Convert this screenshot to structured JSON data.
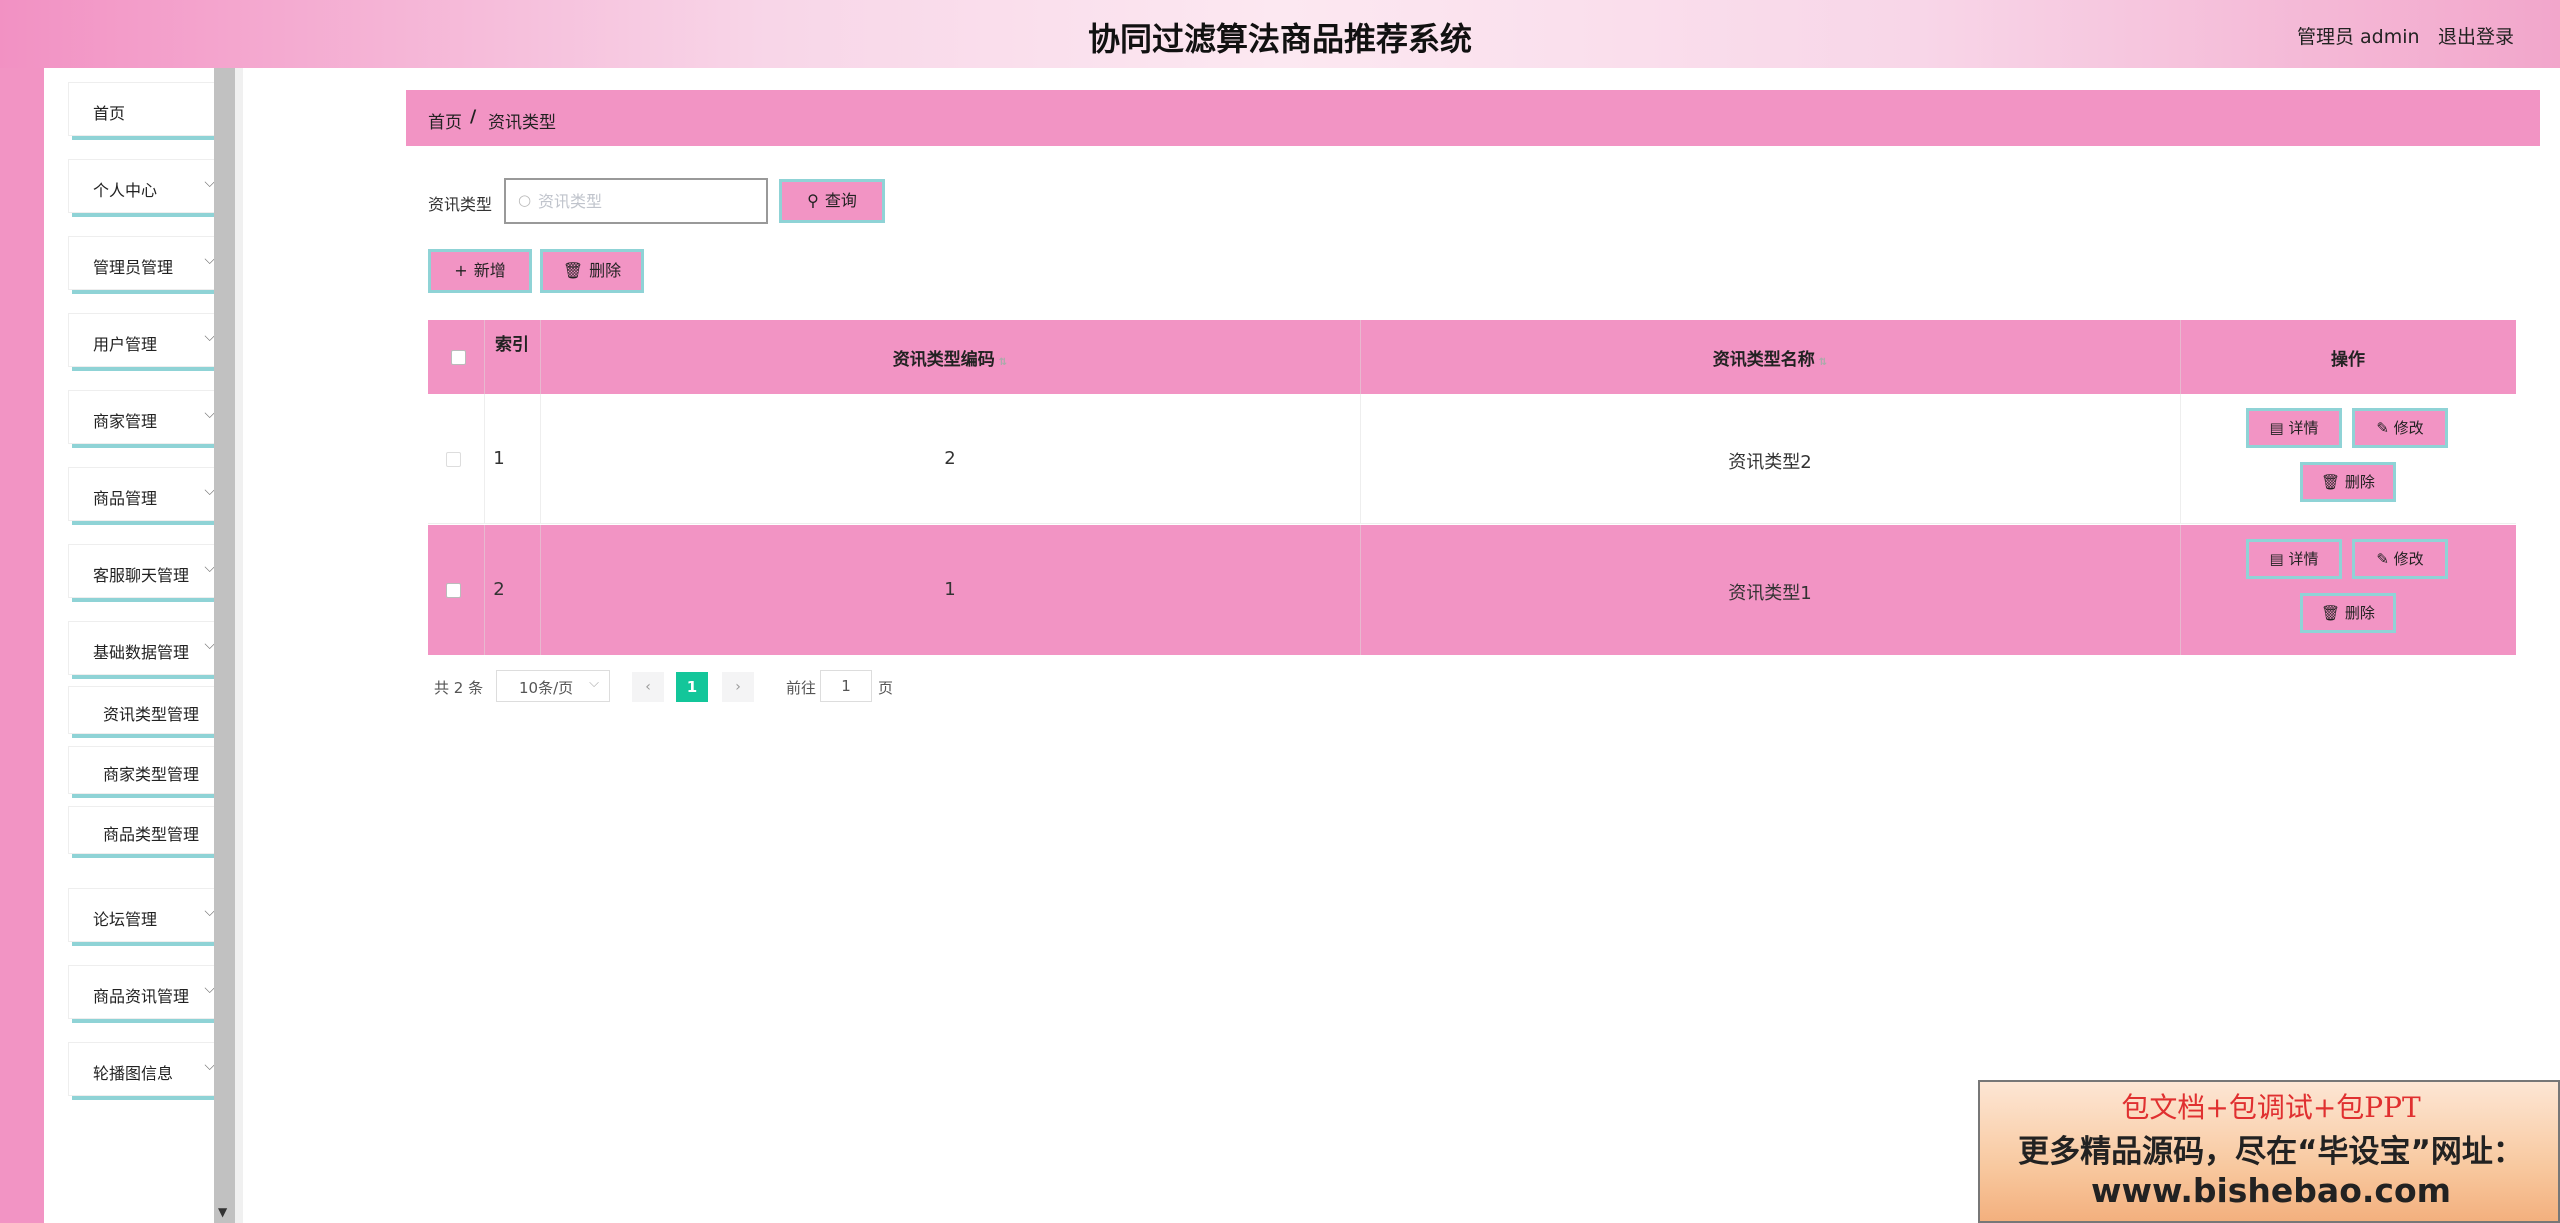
{
  "header": {
    "title": "协同过滤算法商品推荐系统",
    "user": "管理员 admin",
    "logout": "退出登录"
  },
  "sidebar": {
    "items": [
      {
        "label": "首页",
        "has_arrow": false
      },
      {
        "label": "个人中心",
        "has_arrow": true
      },
      {
        "label": "管理员管理",
        "has_arrow": true
      },
      {
        "label": "用户管理",
        "has_arrow": true
      },
      {
        "label": "商家管理",
        "has_arrow": true
      },
      {
        "label": "商品管理",
        "has_arrow": true
      },
      {
        "label": "客服聊天管理",
        "has_arrow": true
      },
      {
        "label": "基础数据管理",
        "has_arrow": true
      }
    ],
    "sub_items": [
      "资讯类型管理",
      "商家类型管理",
      "商品类型管理"
    ],
    "items_after": [
      "论坛管理",
      "商品资讯管理",
      "轮播图信息"
    ]
  },
  "breadcrumb": {
    "home": "首页",
    "sep": "/",
    "current": "资讯类型"
  },
  "search": {
    "label": "资讯类型",
    "placeholder": "资讯类型",
    "value": "",
    "button": "查询"
  },
  "actions": {
    "add": "新增",
    "delete": "删除"
  },
  "table": {
    "headers": {
      "index": "索引",
      "code": "资讯类型编码",
      "name": "资讯类型名称",
      "ops": "操作"
    },
    "rows": [
      {
        "index": "1",
        "code": "2",
        "name": "资讯类型2"
      },
      {
        "index": "2",
        "code": "1",
        "name": "资讯类型1"
      }
    ],
    "op_labels": {
      "detail": "详情",
      "edit": "修改",
      "delete": "删除"
    }
  },
  "pagination": {
    "total": "共 2 条",
    "page_size": "10条/页",
    "current_page": "1",
    "goto_label": "前往",
    "goto_value": "1",
    "page_unit": "页"
  },
  "ad": {
    "line1": "包文档+包调试+包PPT",
    "line2": "更多精品源码，尽在“毕设宝”网址：",
    "line3": "www.bishebao.com"
  },
  "colors": {
    "accent": "#f294c4",
    "border": "#8fd3d6",
    "page_active": "#13c69a"
  }
}
